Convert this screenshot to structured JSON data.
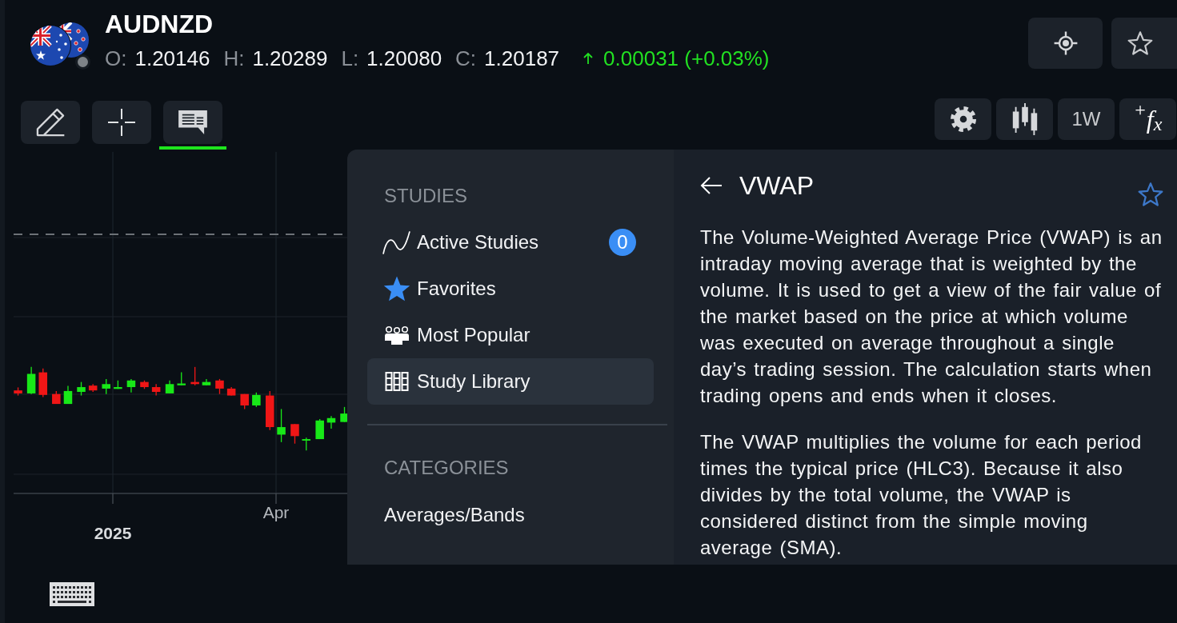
{
  "instrument": {
    "symbol": "AUDNZD",
    "ohlc": [
      {
        "label": "O:",
        "value": "1.20146"
      },
      {
        "label": "H:",
        "value": "1.20289"
      },
      {
        "label": "L:",
        "value": "1.20080"
      },
      {
        "label": "C:",
        "value": "1.20187"
      }
    ],
    "change": {
      "kind": "gain",
      "text": "0.00031 (+0.03%)"
    }
  },
  "header_actions": [
    {
      "kind": "locate"
    },
    {
      "kind": "watchlist"
    }
  ],
  "drawing_tools": [
    {
      "kind": "pencil",
      "selected": false
    },
    {
      "kind": "crosshair",
      "selected": false
    },
    {
      "kind": "notes",
      "selected": true
    }
  ],
  "chart_controls": [
    {
      "kind": "settings"
    },
    {
      "kind": "chart-type"
    },
    {
      "kind": "interval",
      "label": "1W"
    },
    {
      "kind": "formula",
      "label": "$^{+}$*f*$_{x}$"
    }
  ],
  "chart": {
    "x_axis_labels": [
      {
        "kind": "year",
        "text": "2025"
      },
      {
        "kind": "month",
        "text": "Apr"
      }
    ]
  },
  "studies_menu": {
    "heading": "STUDIES",
    "items": [
      {
        "kind": "active",
        "label": "Active Studies",
        "count": "0",
        "selected": false
      },
      {
        "kind": "favorites",
        "label": "Favorites",
        "selected": false
      },
      {
        "kind": "popular",
        "label": "Most Popular",
        "selected": false
      },
      {
        "kind": "library",
        "label": "Study Library",
        "selected": true
      }
    ],
    "categories_heading": "CATEGORIES",
    "categories": [
      {
        "label": "Averages/Bands"
      }
    ]
  },
  "study_detail": {
    "title": "VWAP",
    "favorite": false,
    "paragraphs": [
      "The Volume-Weighted Average Price (VWAP) is an intraday moving average that is weighted by the volume. It is used to get a view of the fair value of the market based on the price at which volume was executed on average throughout a single day’s trading session. The calculation starts when trading opens and ends when it closes.",
      "The VWAP multiplies the volume for each period times the typical price (HLC3). Because it also divides by the total volume, the VWAP is considered distinct from the simple moving average (SMA)."
    ]
  }
}
